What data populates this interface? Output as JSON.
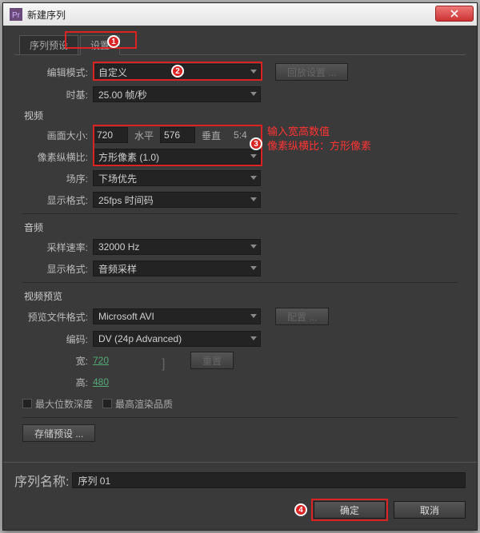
{
  "window": {
    "title": "新建序列"
  },
  "tabs": {
    "preset": "序列预设",
    "settings": "设置"
  },
  "edit_mode": {
    "label": "编辑模式:",
    "value": "自定义",
    "btn": "回放设置 ..."
  },
  "timebase": {
    "label": "时基:",
    "value": "25.00 帧/秒"
  },
  "video": {
    "title": "视频",
    "frame_size_label": "画面大小:",
    "width": "720",
    "h_label": "水平",
    "height": "576",
    "v_label": "垂直",
    "ratio": "5:4",
    "par_label": "像素纵横比:",
    "par_value": "方形像素 (1.0)",
    "field_label": "场序:",
    "field_value": "下场优先",
    "disp_label": "显示格式:",
    "disp_value": "25fps 时间码"
  },
  "audio": {
    "title": "音频",
    "sr_label": "采样速率:",
    "sr_value": "32000 Hz",
    "disp_label": "显示格式:",
    "disp_value": "音频采样"
  },
  "preview": {
    "title": "视频预览",
    "format_label": "预览文件格式:",
    "format_value": "Microsoft AVI",
    "config_btn": "配置 ...",
    "codec_label": "编码:",
    "codec_value": "DV (24p Advanced)",
    "w_label": "宽:",
    "w_value": "720",
    "h_label": "高:",
    "h_value": "480",
    "reset_btn": "重置"
  },
  "checks": {
    "max_depth": "最大位数深度",
    "max_quality": "最高渲染品质"
  },
  "save_preset": "存储预设 ...",
  "seq_name": {
    "label": "序列名称:",
    "value": "序列 01"
  },
  "buttons": {
    "ok": "确定",
    "cancel": "取消"
  },
  "anno": {
    "line1": "输入宽高数值",
    "line2": "像素纵横比：方形像素"
  }
}
